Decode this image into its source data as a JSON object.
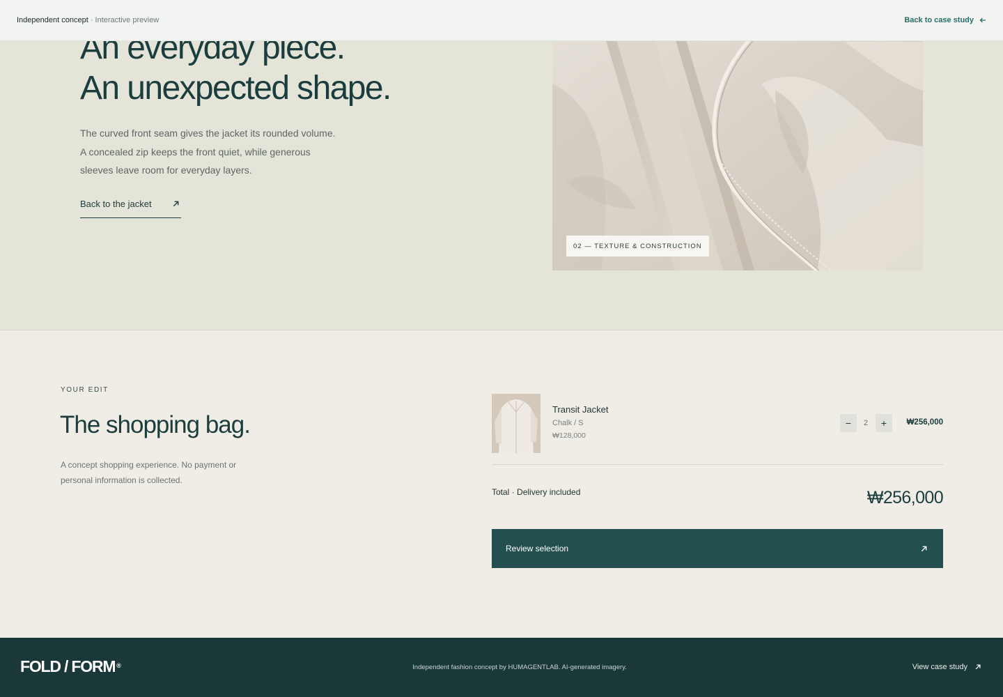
{
  "topbar": {
    "label": "Independent concept",
    "sublabel": "· Interactive preview",
    "back_link": "Back to case study"
  },
  "hero": {
    "heading_line1": "An everyday piece.",
    "heading_line2": "An unexpected shape.",
    "desc_line1": "The curved front seam gives the jacket its rounded volume.",
    "desc_line2": "A concealed zip keeps the front quiet, while generous",
    "desc_line3": "sleeves leave room for everyday layers.",
    "link_label": "Back to the jacket",
    "image_caption": "02 — TEXTURE & CONSTRUCTION"
  },
  "bag": {
    "eyebrow": "YOUR EDIT",
    "title": "The shopping bag.",
    "note_line1": "A concept shopping experience. No payment or",
    "note_line2": "personal information is collected.",
    "item": {
      "name": "Transit Jacket",
      "variant": "Chalk / S",
      "unit_price": "₩128,000",
      "quantity": "2",
      "minus": "−",
      "plus": "+",
      "line_total": "₩256,000"
    },
    "total_label": "Total",
    "total_sep": " · ",
    "total_sublabel": "Delivery included",
    "total_value": "₩256,000",
    "cta_label": "Review selection"
  },
  "footer": {
    "logo": "FOLD / FORM",
    "logo_mark": "®",
    "credit": "Independent fashion concept by HUMAGENTLAB. AI-generated imagery.",
    "case_link": "View case study"
  },
  "icons": {
    "back": "arrow-left-icon",
    "external": "arrow-up-right-icon"
  },
  "colors": {
    "hero_bg": "#e4e4d8",
    "page_bg": "#efede6",
    "accent": "#244f4f",
    "footer_bg": "#1b3839",
    "link_teal": "#2a6b68"
  }
}
